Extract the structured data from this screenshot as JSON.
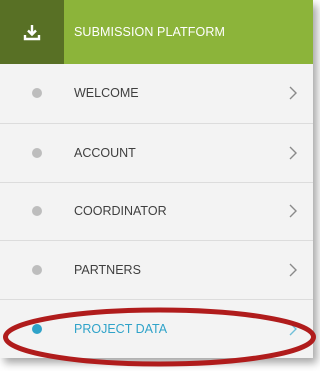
{
  "header": {
    "title": "SUBMISSION PLATFORM",
    "icon": "download-icon",
    "accent": "#8cb43a",
    "icon_bg": "#587025"
  },
  "nav": {
    "items": [
      {
        "label": "WELCOME",
        "active": false
      },
      {
        "label": "ACCOUNT",
        "active": false
      },
      {
        "label": "COORDINATOR",
        "active": false
      },
      {
        "label": "PARTNERS",
        "active": false
      },
      {
        "label": "PROJECT DATA",
        "active": true
      }
    ],
    "inactive_dot_color": "#bdbdbd",
    "active_color": "#2fa3c9"
  },
  "annotation": {
    "highlight_color": "#b01c1c"
  }
}
